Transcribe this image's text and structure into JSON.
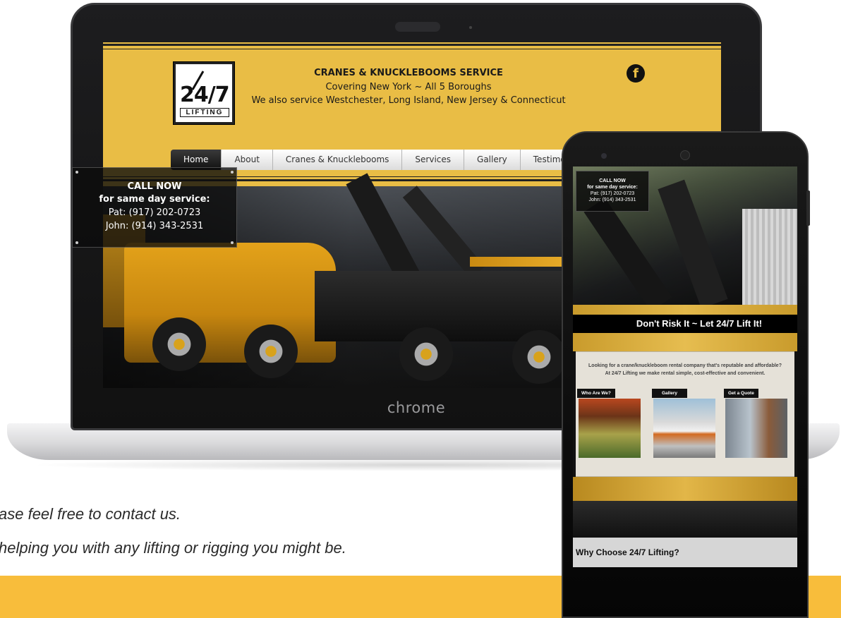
{
  "site": {
    "header": {
      "title": "CRANES & KNUCKLEBOOMS SERVICE",
      "line1": "Covering New York ~  All 5 Boroughs",
      "line2": "We also service Westchester, Long Island, New Jersey & Connecticut"
    },
    "logo": {
      "main": "24/7",
      "sub": "LIFTING"
    },
    "social_icon": "facebook-icon",
    "nav": [
      {
        "label": "Home",
        "active": true
      },
      {
        "label": "About"
      },
      {
        "label": "Cranes & Knucklebooms"
      },
      {
        "label": "Services"
      },
      {
        "label": "Gallery"
      },
      {
        "label": "Testimonials"
      }
    ],
    "call_box": {
      "heading": "CALL NOW",
      "subheading": "for same day service:",
      "phone1": "Pat: (917) 202-0723",
      "phone2": "John: (914) 343-2531"
    }
  },
  "laptop": {
    "brand": "chrome"
  },
  "mobile": {
    "call_box": {
      "heading": "CALL NOW",
      "subheading": "for same day service:",
      "phone1": "Pat: (917) 202-0723",
      "phone2": "John: (914) 343-2531"
    },
    "banner": "Don't Risk It ~ Let 24/7 Lift It!",
    "intro_line1": "Looking for a crane/knuckleboom rental company that's reputable and affordable?",
    "intro_line2": "At 24/7 Lifting we make rental simple, cost-effective and convenient.",
    "cards": [
      {
        "label": "Who Are We?"
      },
      {
        "label": "Gallery"
      },
      {
        "label": "Get a Quote"
      }
    ],
    "why": "Why Choose 24/7 Lifting?"
  },
  "background_text": {
    "line1": "ase feel free to contact us.",
    "line2": "helping you with any lifting or rigging you might be."
  },
  "colors": {
    "brand_gold": "#e9bd45",
    "footer_gold": "#f8bd3b",
    "dark": "#111111"
  }
}
